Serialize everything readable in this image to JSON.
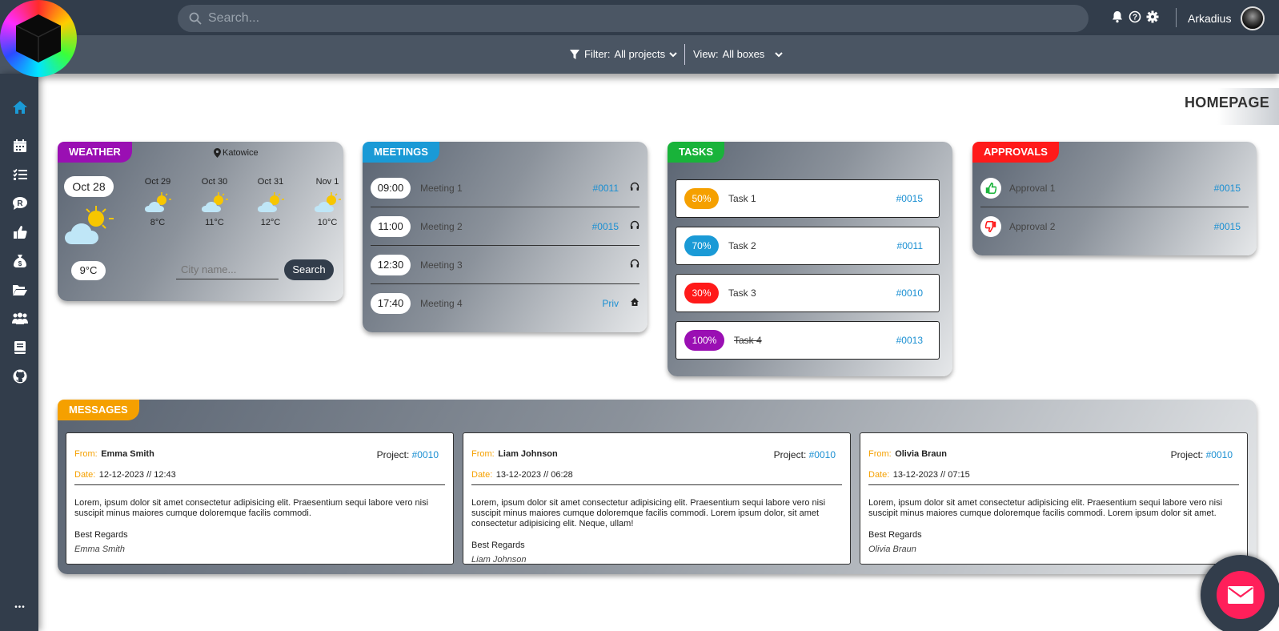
{
  "header": {
    "search_placeholder": "Search...",
    "username": "Arkadius"
  },
  "subbar": {
    "filter_label": "Filter:",
    "filter_value": "All projects",
    "view_label": "View:",
    "view_value": "All boxes"
  },
  "sidebar": {
    "items": [
      "home-icon",
      "calendar-icon",
      "tasks-icon",
      "review-icon",
      "approve-icon",
      "money-icon",
      "folder-icon",
      "team-icon",
      "book-icon",
      "github-icon"
    ]
  },
  "page": {
    "title": "HOMEPAGE"
  },
  "weather": {
    "label": "WEATHER",
    "location": "Katowice",
    "today_date": "Oct 28",
    "today_temp": "9°C",
    "forecast": [
      {
        "date": "Oct 29",
        "temp": "8°C"
      },
      {
        "date": "Oct 30",
        "temp": "11°C"
      },
      {
        "date": "Oct 31",
        "temp": "12°C"
      },
      {
        "date": "Nov 1",
        "temp": "10°C"
      }
    ],
    "city_placeholder": "City name...",
    "search_button": "Search",
    "color": "#9a0fb3"
  },
  "meetings": {
    "label": "MEETINGS",
    "color": "#1a9ad6",
    "items": [
      {
        "time": "09:00",
        "name": "Meeting 1",
        "project": "#0011",
        "icon": "headphones-icon"
      },
      {
        "time": "11:00",
        "name": "Meeting 2",
        "project": "#0015",
        "icon": "headphones-icon"
      },
      {
        "time": "12:30",
        "name": "Meeting 3",
        "project": "",
        "icon": "headphones-icon"
      },
      {
        "time": "17:40",
        "name": "Meeting 4",
        "project": "Priv",
        "icon": "home-icon"
      }
    ]
  },
  "tasks": {
    "label": "TASKS",
    "color": "#19b33a",
    "items": [
      {
        "progress": "50%",
        "name": "Task 1",
        "project": "#0015",
        "color": "#f5a000"
      },
      {
        "progress": "70%",
        "name": "Task 2",
        "project": "#0011",
        "color": "#1a9ad6"
      },
      {
        "progress": "30%",
        "name": "Task 3",
        "project": "#0010",
        "color": "#ff1a1a"
      },
      {
        "progress": "100%",
        "name": "Task 4",
        "project": "#0013",
        "color": "#9a0fb3"
      }
    ]
  },
  "approvals": {
    "label": "APPROVALS",
    "color": "#ff1a1a",
    "items": [
      {
        "name": "Approval 1",
        "project": "#0015",
        "icon": "thumbs-up-icon"
      },
      {
        "name": "Approval 2",
        "project": "#0015",
        "icon": "thumbs-down-icon"
      }
    ]
  },
  "messages": {
    "label": "MESSAGES",
    "color": "#f5a000",
    "from_label": "From:",
    "date_label": "Date:",
    "project_label": "Project:",
    "items": [
      {
        "from": "Emma Smith",
        "date": "12-12-2023 // 12:43",
        "project": "#0010",
        "body": "Lorem, ipsum dolor sit amet consectetur adipisicing elit. Praesentium sequi labore vero nisi suscipit minus maiores cumque doloremque facilis commodi.",
        "regards": "Best Regards",
        "signature": "Emma Smith"
      },
      {
        "from": "Liam Johnson",
        "date": "13-12-2023 // 06:28",
        "project": "#0010",
        "body": "Lorem, ipsum dolor sit amet consectetur adipisicing elit. Praesentium sequi labore vero nisi suscipit minus maiores cumque doloremque facilis commodi. Lorem ipsum dolor, sit amet consectetur adipisicing elit. Neque, ullam!",
        "regards": "Best Regards",
        "signature": "Liam Johnson"
      },
      {
        "from": "Olivia Braun",
        "date": "13-12-2023 // 07:15",
        "project": "#0010",
        "body": "Lorem, ipsum dolor sit amet consectetur adipisicing elit. Praesentium sequi labore vero nisi suscipit minus maiores cumque doloremque facilis commodi. Lorem ipsum dolor sit amet.",
        "regards": "Best Regards",
        "signature": "Olivia Braun"
      }
    ]
  },
  "sidebar_more": "•••"
}
